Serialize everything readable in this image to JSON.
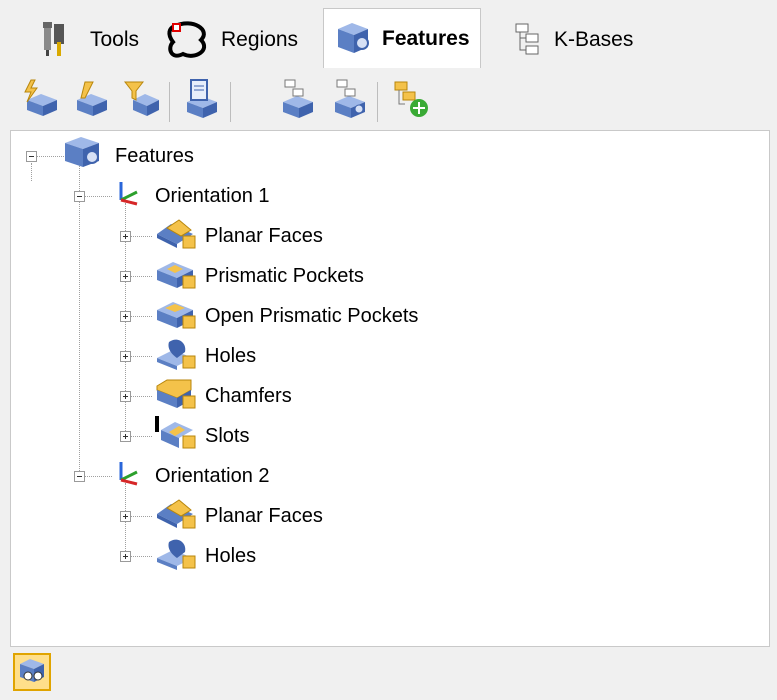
{
  "tabs": [
    {
      "label": "Tools",
      "icon": "tools-icon"
    },
    {
      "label": "Regions",
      "icon": "regions-icon"
    },
    {
      "label": "Features",
      "icon": "features-icon",
      "active": true
    },
    {
      "label": "K-Bases",
      "icon": "kbases-icon"
    }
  ],
  "toolbar": [
    "auto-feature-detect-icon",
    "feature-edit-icon",
    "feature-filter-icon",
    "feature-report-icon",
    "tree-collapse-icon",
    "tree-link-icon",
    "add-tree-item-icon"
  ],
  "tree": {
    "root": {
      "label": "Features",
      "icon": "features-icon"
    },
    "orientations": [
      {
        "label": "Orientation 1",
        "children": [
          "Planar Faces",
          "Prismatic Pockets",
          "Open Prismatic Pockets",
          "Holes",
          "Chamfers",
          "Slots"
        ]
      },
      {
        "label": "Orientation 2",
        "children": [
          "Planar Faces",
          "Holes"
        ]
      }
    ]
  },
  "statusbar": {
    "icon": "feature-view-icon"
  },
  "colors": {
    "accent": "#e0a400",
    "blue": "#6a8fd4",
    "gold": "#f4c24a"
  }
}
